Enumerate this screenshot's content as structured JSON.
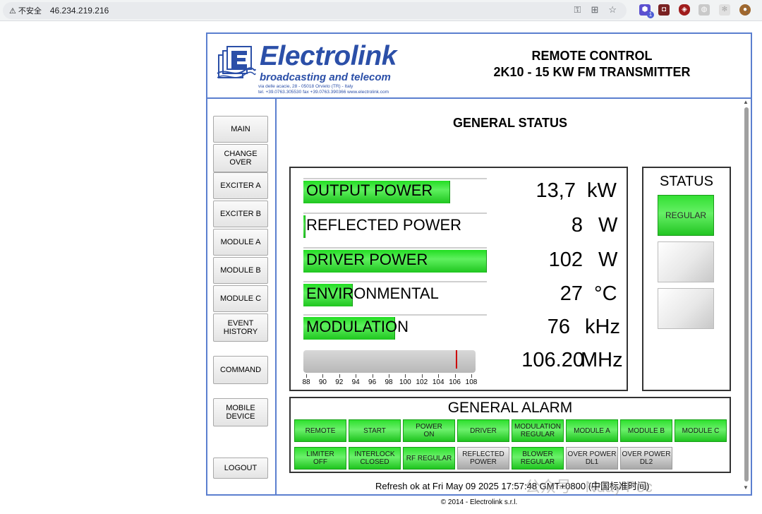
{
  "browser": {
    "security_label": "不安全",
    "url": "46.234.219.216",
    "extension_badge": "1"
  },
  "header": {
    "brand": "Electrolink",
    "tagline": "broadcasting and telecom",
    "address_line1": "via delle acacie, 28 - 05018 Orvieto (TR) - Italy",
    "address_line2": "tel. +39.0763.305530 fax +39.0763.390366 www.electrolink.com",
    "title_line1": "REMOTE CONTROL",
    "title_line2": "2K10 - 15 KW FM TRANSMITTER",
    "brand_color": "#2b4fa8"
  },
  "nav": [
    {
      "label": "MAIN"
    },
    {
      "label": "CHANGE OVER"
    },
    {
      "label": "EXCITER A"
    },
    {
      "label": "EXCITER B"
    },
    {
      "label": "MODULE A"
    },
    {
      "label": "MODULE B"
    },
    {
      "label": "MODULE C"
    },
    {
      "label": "EVENT HISTORY"
    },
    {
      "label": "COMMAND"
    },
    {
      "label": "MOBILE DEVICE"
    },
    {
      "label": "LOGOUT"
    }
  ],
  "main": {
    "title": "GENERAL STATUS",
    "measurements": [
      {
        "label": "OUTPUT POWER",
        "value": "13,7",
        "unit": "kW",
        "level": 0.8
      },
      {
        "label": "REFLECTED POWER",
        "value": "8",
        "unit": "W",
        "level": 0.01
      },
      {
        "label": "DRIVER POWER",
        "value": "102",
        "unit": "W",
        "level": 1.0
      },
      {
        "label": "ENVIRONMENTAL",
        "value": "27",
        "unit": "°C",
        "level": 0.27
      },
      {
        "label": "MODULATION",
        "value": "76",
        "unit": "kHz",
        "level": 0.5
      }
    ],
    "frequency": {
      "value": "106.20",
      "unit": "MHz",
      "scale_min": 88,
      "scale_max": 108,
      "current": 106.2,
      "ticks": [
        "88",
        "90",
        "92",
        "94",
        "96",
        "98",
        "100",
        "102",
        "104",
        "106",
        "108"
      ]
    },
    "status": {
      "title": "STATUS",
      "indicators": [
        {
          "label": "REGULAR",
          "state": "on"
        },
        {
          "label": "",
          "state": "off"
        },
        {
          "label": "",
          "state": "off"
        }
      ]
    },
    "alarm": {
      "title": "GENERAL ALARM",
      "row1": [
        {
          "label": "REMOTE",
          "state": "green"
        },
        {
          "label": "START",
          "state": "green"
        },
        {
          "label": "POWER ON",
          "state": "green"
        },
        {
          "label": "DRIVER",
          "state": "green"
        },
        {
          "label": "MODULATION REGULAR",
          "state": "green"
        },
        {
          "label": "MODULE A",
          "state": "green"
        },
        {
          "label": "MODULE B",
          "state": "green"
        },
        {
          "label": "MODULE C",
          "state": "green"
        }
      ],
      "row2": [
        {
          "label": "LIMITER OFF",
          "state": "green"
        },
        {
          "label": "INTERLOCK CLOSED",
          "state": "green"
        },
        {
          "label": "RF REGULAR",
          "state": "green"
        },
        {
          "label": "REFLECTED POWER",
          "state": "gray"
        },
        {
          "label": "BLOWER REGULAR",
          "state": "green"
        },
        {
          "label": "OVER POWER DL1",
          "state": "gray"
        },
        {
          "label": "OVER POWER DL2",
          "state": "gray"
        }
      ]
    },
    "refresh_text": "Refresh ok at Fri May 09 2025 17:57:48 GMT+0800 (中国标准时间)"
  },
  "footer": "© 2014 - Electrolink s.r.l.",
  "watermark": "公众号 · Nday Poc",
  "colors": {
    "panel_border": "#5b7fcf",
    "green": "#2ee02e",
    "needle": "#cc0000"
  }
}
